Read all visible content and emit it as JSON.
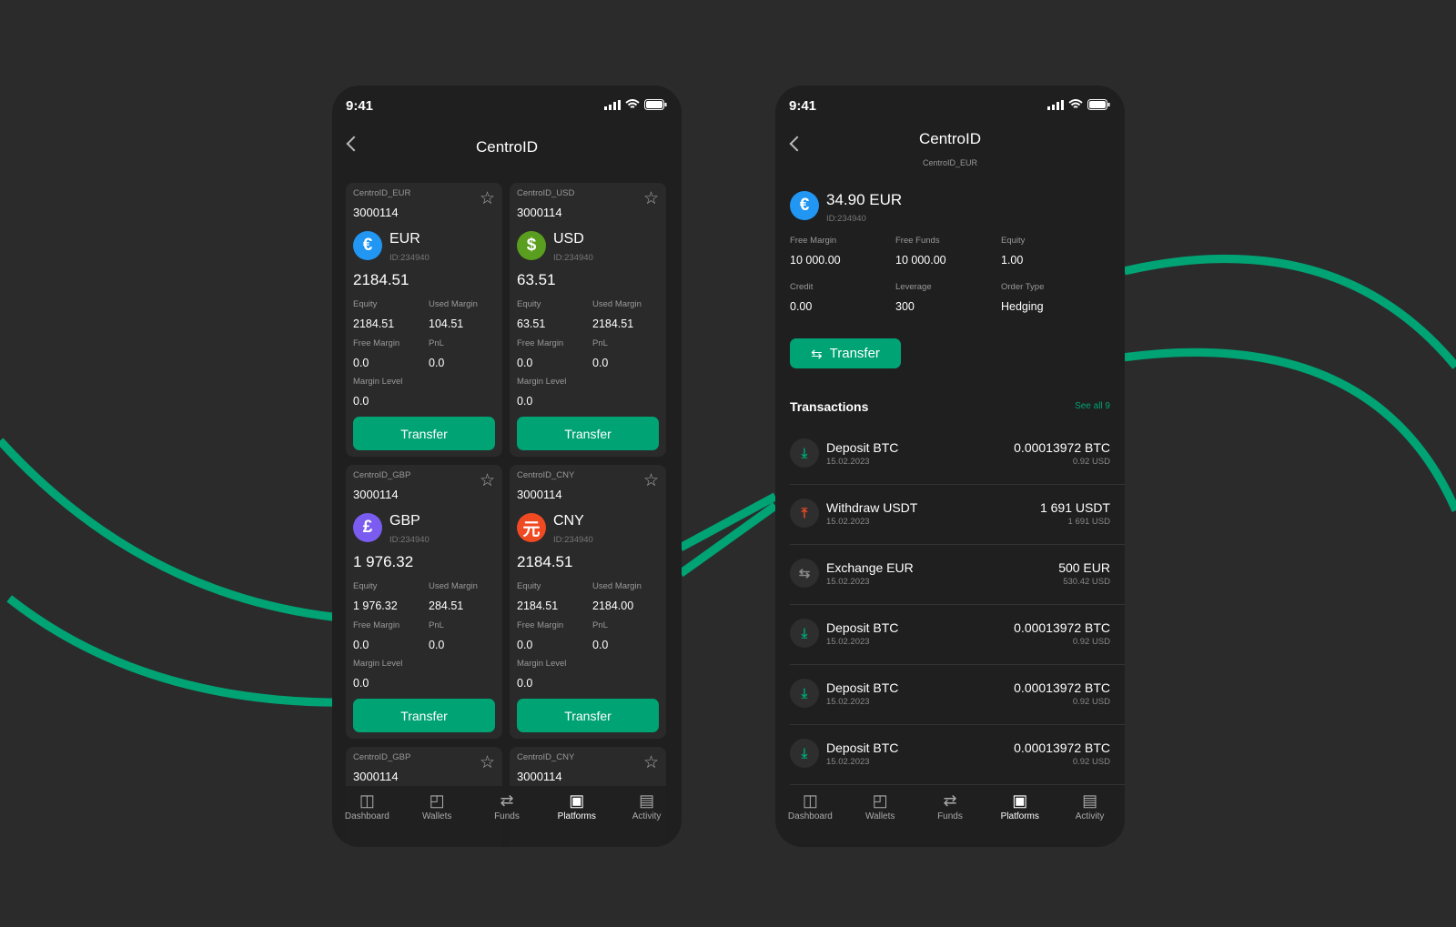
{
  "colors": {
    "accent": "#00a374",
    "background": "#2b2b2b",
    "phone": "#1f1f1f",
    "card": "#2a2a2a"
  },
  "status": {
    "time": "9:41"
  },
  "left": {
    "title": "CentroID",
    "transfer_label": "Transfer",
    "labels": {
      "equity": "Equity",
      "used_margin": "Used Margin",
      "free_margin": "Free Margin",
      "pnl": "PnL",
      "margin_level": "Margin Level"
    },
    "cards": [
      {
        "account_name": "CentroID_EUR",
        "number": "3000114",
        "currency": "EUR",
        "symbol": "€",
        "coin_color": "#2196f3",
        "id": "ID:234940",
        "balance": "2184.51",
        "equity": "2184.51",
        "used_margin": "104.51",
        "free_margin": "0.0",
        "pnl": "0.0",
        "margin_level": "0.0"
      },
      {
        "account_name": "CentroID_USD",
        "number": "3000114",
        "currency": "USD",
        "symbol": "$",
        "coin_color": "#5a9e1f",
        "id": "ID:234940",
        "balance": "63.51",
        "equity": "63.51",
        "used_margin": "2184.51",
        "free_margin": "0.0",
        "pnl": "0.0",
        "margin_level": "0.0"
      },
      {
        "account_name": "CentroID_GBP",
        "number": "3000114",
        "currency": "GBP",
        "symbol": "£",
        "coin_color": "#7b5cf0",
        "id": "ID:234940",
        "balance": "1 976.32",
        "equity": "1 976.32",
        "used_margin": "284.51",
        "free_margin": "0.0",
        "pnl": "0.0",
        "margin_level": "0.0"
      },
      {
        "account_name": "CentroID_CNY",
        "number": "3000114",
        "currency": "CNY",
        "symbol": "元",
        "coin_color": "#f04a23",
        "id": "ID:234940",
        "balance": "2184.51",
        "equity": "2184.51",
        "used_margin": "2184.00",
        "free_margin": "0.0",
        "pnl": "0.0",
        "margin_level": "0.0"
      },
      {
        "account_name": "CentroID_GBP",
        "number": "3000114"
      },
      {
        "account_name": "CentroID_CNY",
        "number": "3000114"
      }
    ]
  },
  "right": {
    "title": "CentroID",
    "subtitle": "CentroID_EUR",
    "balance": "34.90 EUR",
    "id": "ID:234940",
    "stats": [
      {
        "label": "Free Margin",
        "value": "10 000.00"
      },
      {
        "label": "Free Funds",
        "value": "10 000.00"
      },
      {
        "label": "Equity",
        "value": "1.00"
      },
      {
        "label": "Credit",
        "value": "0.00"
      },
      {
        "label": "Leverage",
        "value": "300"
      },
      {
        "label": "Order Type",
        "value": "Hedging"
      }
    ],
    "transfer_label": "Transfer",
    "transactions_title": "Transactions",
    "see_all": "See all 9",
    "transactions": [
      {
        "type": "deposit",
        "name": "Deposit BTC",
        "date": "15.02.2023",
        "amount": "0.00013972 BTC",
        "usd": "0.92 USD"
      },
      {
        "type": "withdraw",
        "name": "Withdraw USDT",
        "date": "15.02.2023",
        "amount": "1 691 USDT",
        "usd": "1 691 USD"
      },
      {
        "type": "exchange",
        "name": "Exchange EUR",
        "date": "15.02.2023",
        "amount": "500 EUR",
        "usd": "530.42 USD"
      },
      {
        "type": "deposit",
        "name": "Deposit BTC",
        "date": "15.02.2023",
        "amount": "0.00013972 BTC",
        "usd": "0.92 USD"
      },
      {
        "type": "deposit",
        "name": "Deposit BTC",
        "date": "15.02.2023",
        "amount": "0.00013972 BTC",
        "usd": "0.92 USD"
      },
      {
        "type": "deposit",
        "name": "Deposit BTC",
        "date": "15.02.2023",
        "amount": "0.00013972 BTC",
        "usd": "0.92 USD"
      }
    ]
  },
  "nav": [
    {
      "label": "Dashboard",
      "icon": "dashboard-icon"
    },
    {
      "label": "Wallets",
      "icon": "wallet-icon"
    },
    {
      "label": "Funds",
      "icon": "transfer-arrows-icon"
    },
    {
      "label": "Platforms",
      "icon": "chart-icon",
      "active": true
    },
    {
      "label": "Activity",
      "icon": "document-icon"
    }
  ]
}
